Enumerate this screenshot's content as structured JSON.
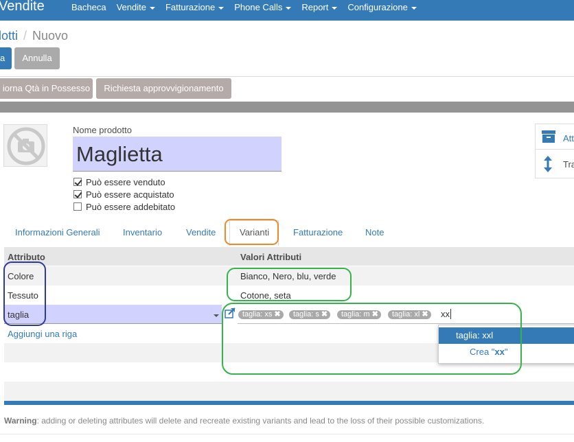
{
  "navbar": {
    "app_title": "Vendite",
    "menu": [
      "Bacheca",
      "Vendite",
      "Fatturazione",
      "Phone Calls",
      "Report",
      "Configurazione"
    ],
    "menu_has_dropdown": [
      false,
      true,
      true,
      true,
      true,
      true
    ]
  },
  "breadcrumb": {
    "parent": "lotti",
    "separator": "/",
    "current": "Nuovo"
  },
  "buttons": {
    "save": "a",
    "cancel": "Annulla",
    "update_qty": "iorna Qtà in Possesso",
    "procurement": "Richiesta approvvigionamento"
  },
  "product": {
    "name_label": "Nome prodotto",
    "name": "Maglietta",
    "checks": [
      {
        "label": "Può essere venduto",
        "checked": true
      },
      {
        "label": "Può essere acquistato",
        "checked": true
      },
      {
        "label": "Può essere addebitato",
        "checked": false
      }
    ],
    "photo_icon": "no-camera-icon"
  },
  "smart_buttons": [
    {
      "label": "Att",
      "icon": "archive-icon"
    },
    {
      "label": "Tra",
      "icon": "updown-arrow-icon"
    }
  ],
  "tabs": [
    "Informazioni Generali",
    "Inventario",
    "Vendite",
    "Varianti",
    "Fatturazione",
    "Note"
  ],
  "active_tab": "Varianti",
  "table": {
    "headers": [
      "Attributo",
      "Valori Attributi"
    ],
    "rows": [
      {
        "attribute": "Colore",
        "values": "Bianco, Nero, blu, verde"
      },
      {
        "attribute": "Tessuto",
        "values": "Cotone, seta"
      }
    ],
    "editing_row": {
      "attribute": "taglia",
      "tags": [
        "taglia: xs",
        "taglia: s",
        "taglia: m",
        "taglia: xl"
      ],
      "typed": "xx"
    },
    "add_line": "Aggiungi una riga"
  },
  "autocomplete": {
    "item": "taglia: xxl",
    "create_prefix": "Crea \"",
    "create_value": "xx",
    "create_suffix": "\""
  },
  "warning": {
    "bold": "Warning",
    "text": ": adding or deleting attributes will delete and recreate existing variants and lead to the loss of their possible customizations."
  },
  "colors": {
    "brand": "#337ab7",
    "required_field": "#d2d2ff",
    "annotation_orange": "#f0882a",
    "annotation_navy": "#2b3a9b",
    "annotation_green": "#35b34a"
  }
}
